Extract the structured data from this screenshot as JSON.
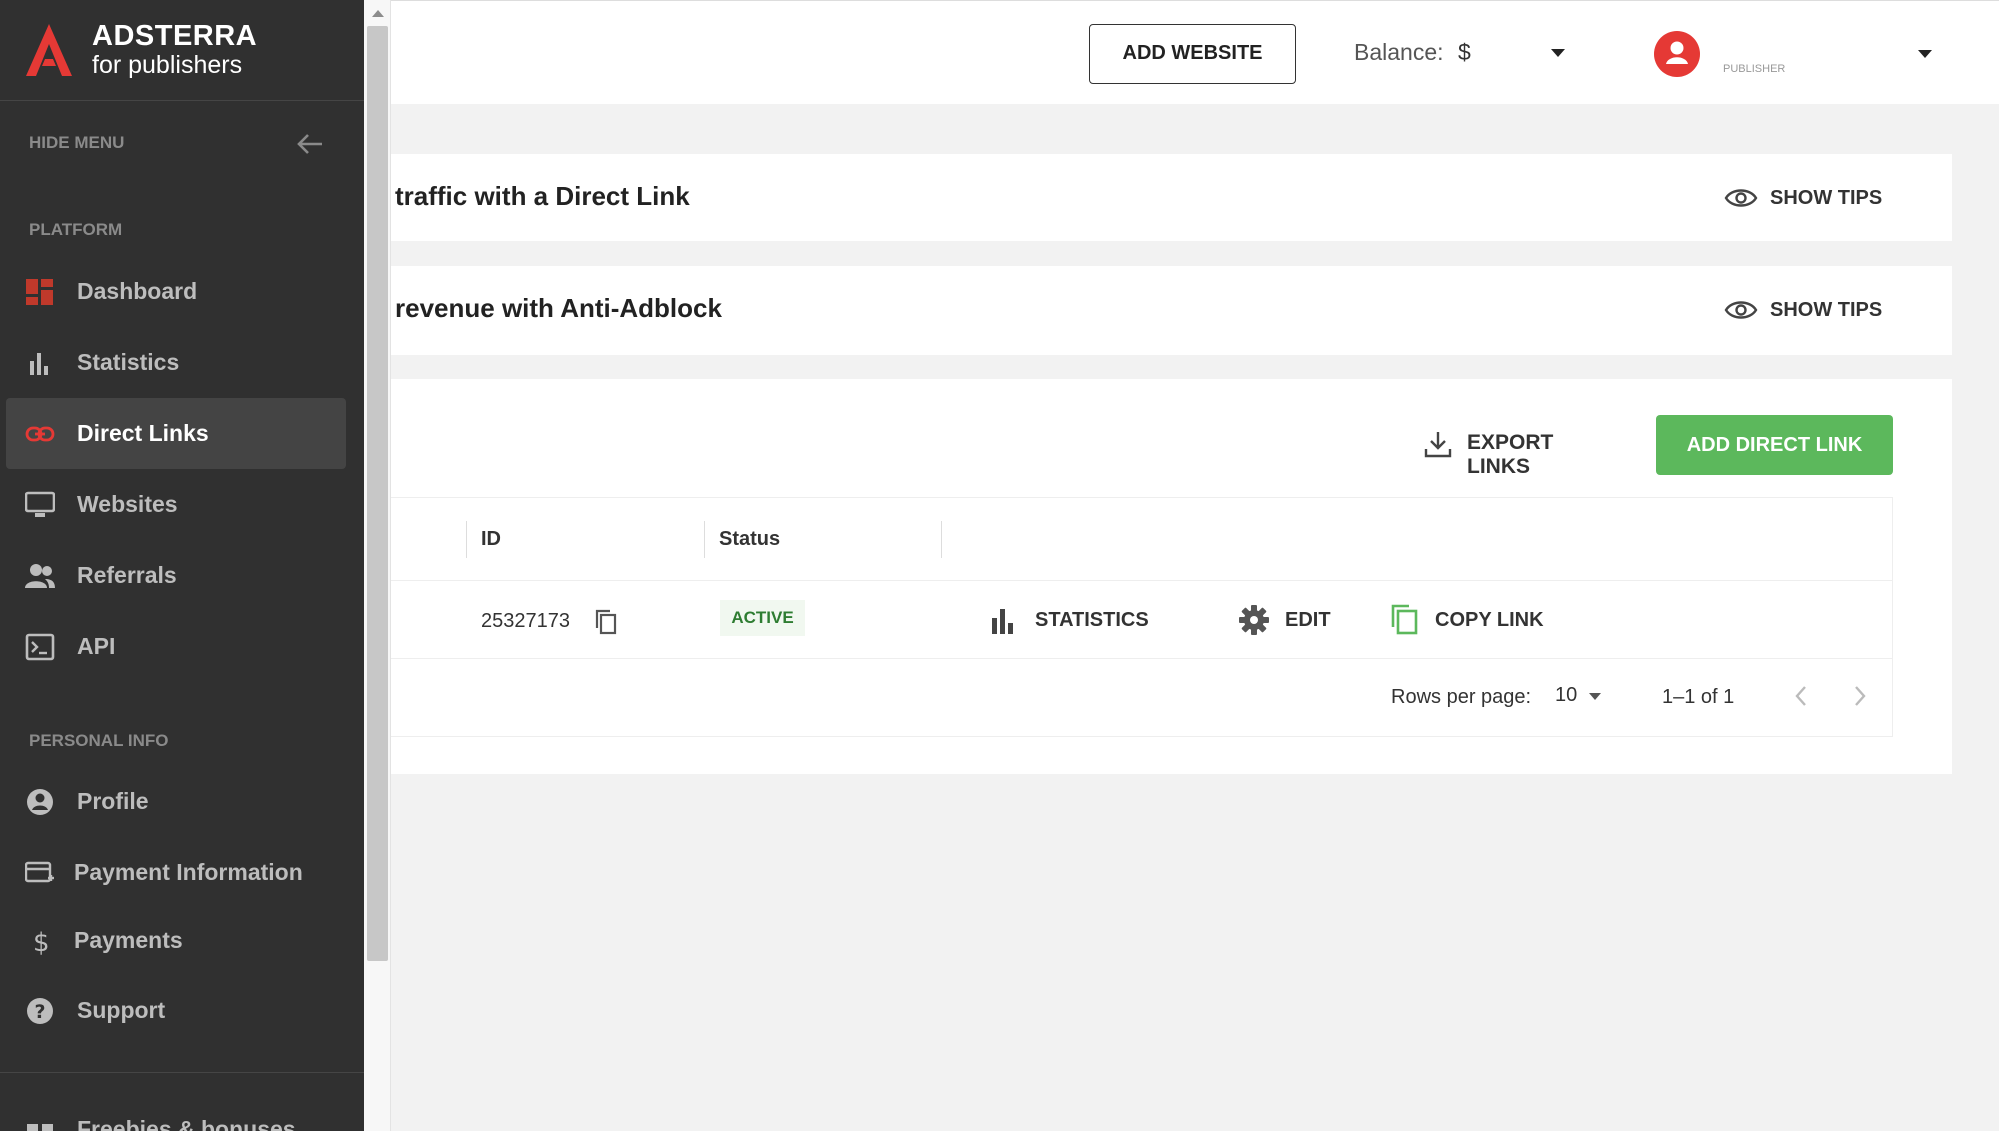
{
  "brand": {
    "title": "ADSTERRA",
    "subtitle": "for publishers",
    "accent": "#e53935"
  },
  "sidebar": {
    "hide_menu": "HIDE MENU",
    "platform_label": "PLATFORM",
    "personal_label": "PERSONAL INFO",
    "items": [
      {
        "label": "Dashboard",
        "icon": "dashboard-icon"
      },
      {
        "label": "Statistics",
        "icon": "bar-chart-icon"
      },
      {
        "label": "Direct Links",
        "icon": "link-icon",
        "active": true
      },
      {
        "label": "Websites",
        "icon": "monitor-icon"
      },
      {
        "label": "Referrals",
        "icon": "users-icon"
      },
      {
        "label": "API",
        "icon": "terminal-icon"
      },
      {
        "label": "Profile",
        "icon": "account-icon"
      },
      {
        "label": "Payment Information",
        "icon": "credit-card-icon"
      },
      {
        "label": "Payments",
        "icon": "dollar-icon"
      },
      {
        "label": "Support",
        "icon": "help-icon"
      },
      {
        "label": "Freebies & bonuses",
        "icon": "gift-icon"
      }
    ]
  },
  "topbar": {
    "add_website": "ADD WEBSITE",
    "balance_label": "Balance:",
    "balance_value": "$",
    "user_role": "PUBLISHER"
  },
  "tips": [
    {
      "title": "traffic with a Direct Link",
      "action": "SHOW TIPS"
    },
    {
      "title": "revenue with Anti-Adblock",
      "action": "SHOW TIPS"
    }
  ],
  "links": {
    "export": "EXPORT LINKS",
    "add": "ADD DIRECT LINK",
    "columns": [
      "ID",
      "Status"
    ],
    "rows": [
      {
        "id": "25327173",
        "status": "ACTIVE",
        "statistics": "STATISTICS",
        "edit": "EDIT",
        "copy": "COPY LINK"
      }
    ],
    "rows_per_page_label": "Rows per page:",
    "rows_per_page_value": "10",
    "range": "1–1 of 1"
  },
  "colors": {
    "sidebar_bg": "#303030",
    "add_button": "#5cb85c",
    "active_status": "#2e7d32"
  }
}
